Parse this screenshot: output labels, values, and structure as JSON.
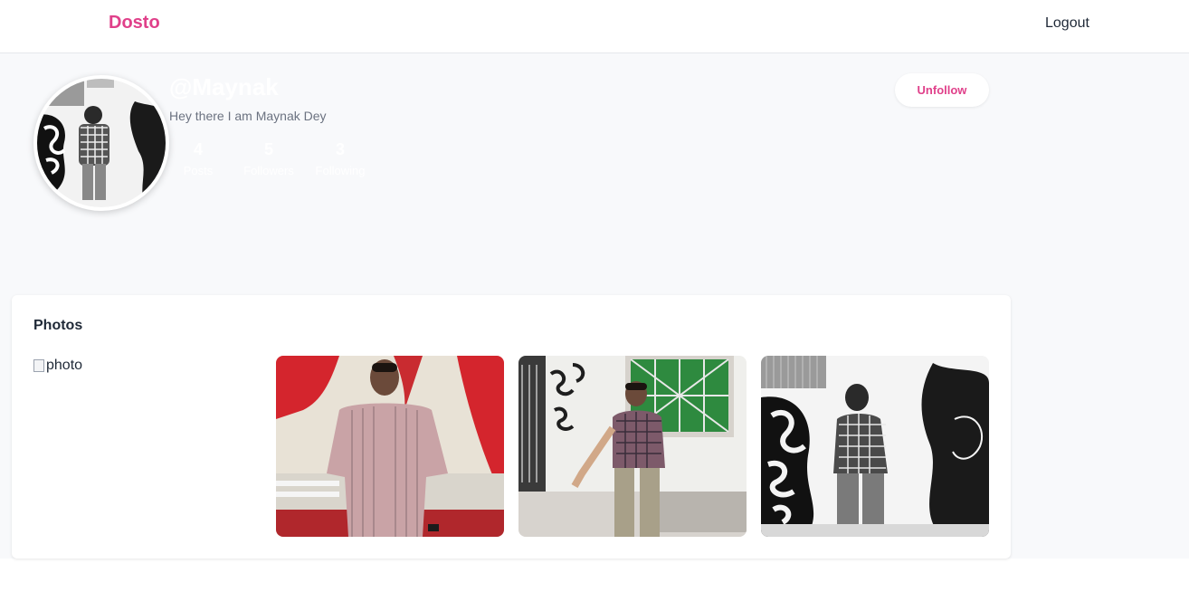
{
  "navbar": {
    "brand": "Dosto",
    "logout_label": "Logout"
  },
  "profile": {
    "username": "@Maynak",
    "bio": "Hey there I am Maynak Dey",
    "stats": [
      {
        "value": "4",
        "label": "Posts"
      },
      {
        "value": "5",
        "label": "Followers"
      },
      {
        "value": "3",
        "label": "Following"
      }
    ],
    "unfollow_label": "Unfollow"
  },
  "photos": {
    "title": "Photos",
    "broken_alt": "photo"
  },
  "colors": {
    "brand": "#e0408a",
    "page_background": "#f8f9fb",
    "card_background": "#ffffff"
  }
}
